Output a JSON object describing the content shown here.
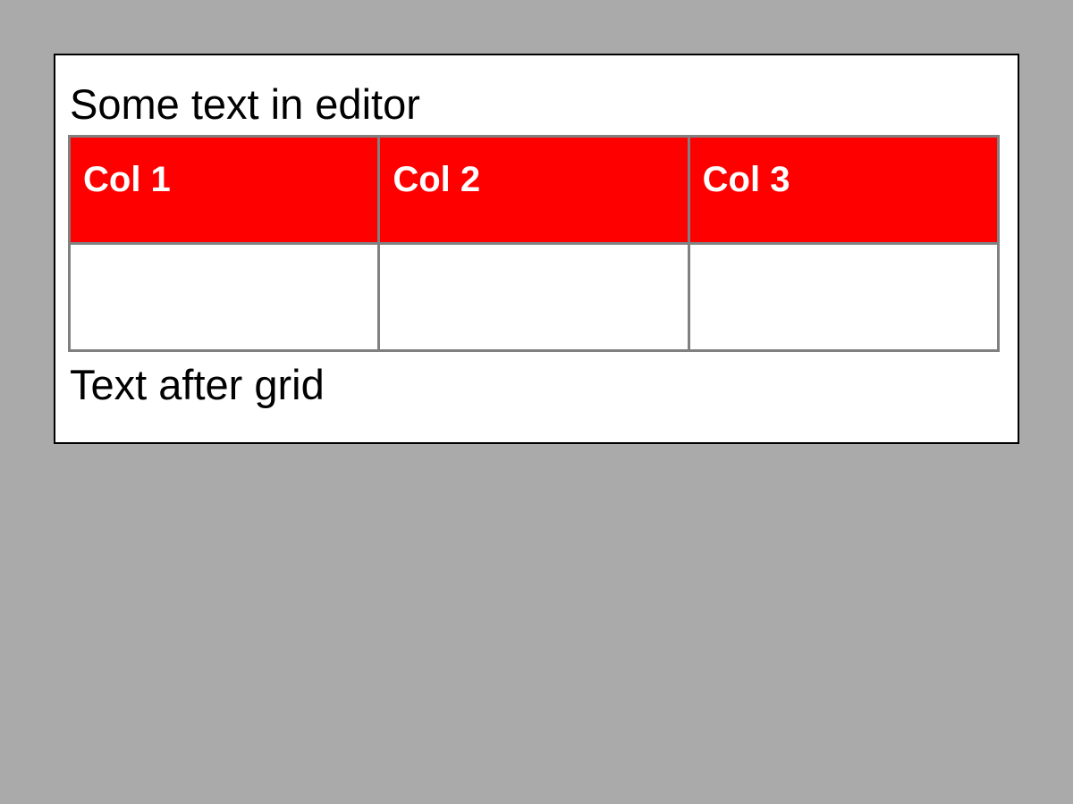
{
  "editor": {
    "text_before": "Some text in editor",
    "text_after": "Text after grid",
    "grid": {
      "columns": [
        "Col 1",
        "Col 2",
        "Col 3"
      ],
      "rows": [
        [
          "",
          "",
          ""
        ]
      ]
    }
  },
  "colors": {
    "page_background": "#aaaaaa",
    "editor_background": "#ffffff",
    "editor_border": "#000000",
    "header_background": "#ff0000",
    "header_text": "#ffffff",
    "grid_border": "#808080"
  }
}
